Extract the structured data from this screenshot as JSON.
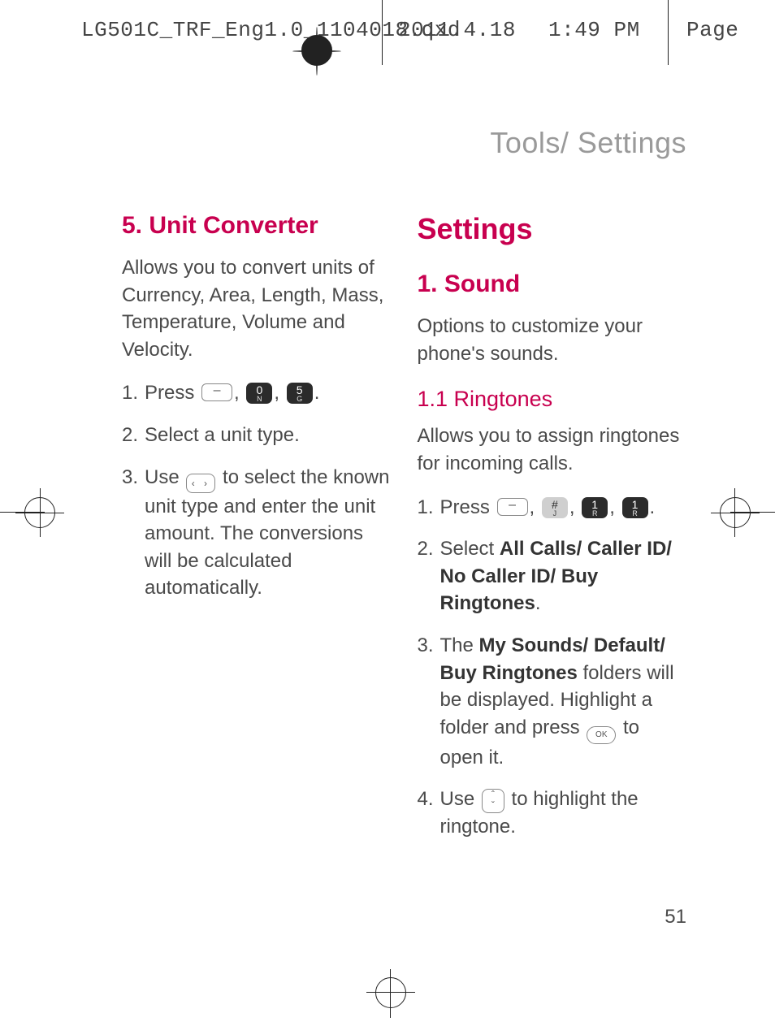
{
  "header": {
    "filename": "LG501C_TRF_Eng1.0_1104018.qxd",
    "date": "2011.4.18",
    "time": "1:49 PM",
    "page_label": "Page"
  },
  "running_head": "Tools/ Settings",
  "page_number": "51",
  "left": {
    "h2": "5. Unit Converter",
    "blurb": "Allows you to convert units of Currency, Area, Length, Mass, Temperature, Volume and Velocity.",
    "steps": [
      {
        "pre": "Press ",
        "keys": [
          "softkey",
          "key-0-N",
          "key-5-G"
        ],
        "post": "."
      },
      {
        "text": "Select a unit type."
      },
      {
        "pre": "Use ",
        "keys": [
          "nav-lr"
        ],
        "post": " to select the known unit type and enter the unit amount. The conversions will be calculated automatically."
      }
    ]
  },
  "right": {
    "h1": "Settings",
    "h2": "1. Sound",
    "blurb": "Options to customize your phone's sounds.",
    "h3": "1.1 Ringtones",
    "sub_blurb": "Allows you to assign ringtones for incoming calls.",
    "steps": [
      {
        "pre": "Press ",
        "keys": [
          "softkey",
          "key-hash",
          "key-1-R",
          "key-1-R"
        ],
        "post": "."
      },
      {
        "pre": "Select ",
        "bold": "All Calls/ Caller ID/ No Caller ID/ Buy Ringtones",
        "post": "."
      },
      {
        "pre": "The ",
        "bold": "My Sounds/ Default/ Buy Ringtones",
        "mid": " folders will be displayed. Highlight a folder and press ",
        "keys": [
          "ok"
        ],
        "post": " to open it."
      },
      {
        "pre": "Use ",
        "keys": [
          "nav-ud"
        ],
        "post": " to highlight the ringtone."
      }
    ]
  },
  "key_labels": {
    "key-0-N": {
      "main": "0",
      "sub": "N"
    },
    "key-5-G": {
      "main": "5",
      "sub": "G"
    },
    "key-hash": {
      "main": "#",
      "sub": "J"
    },
    "key-1-R": {
      "main": "1",
      "sub": "R"
    }
  }
}
